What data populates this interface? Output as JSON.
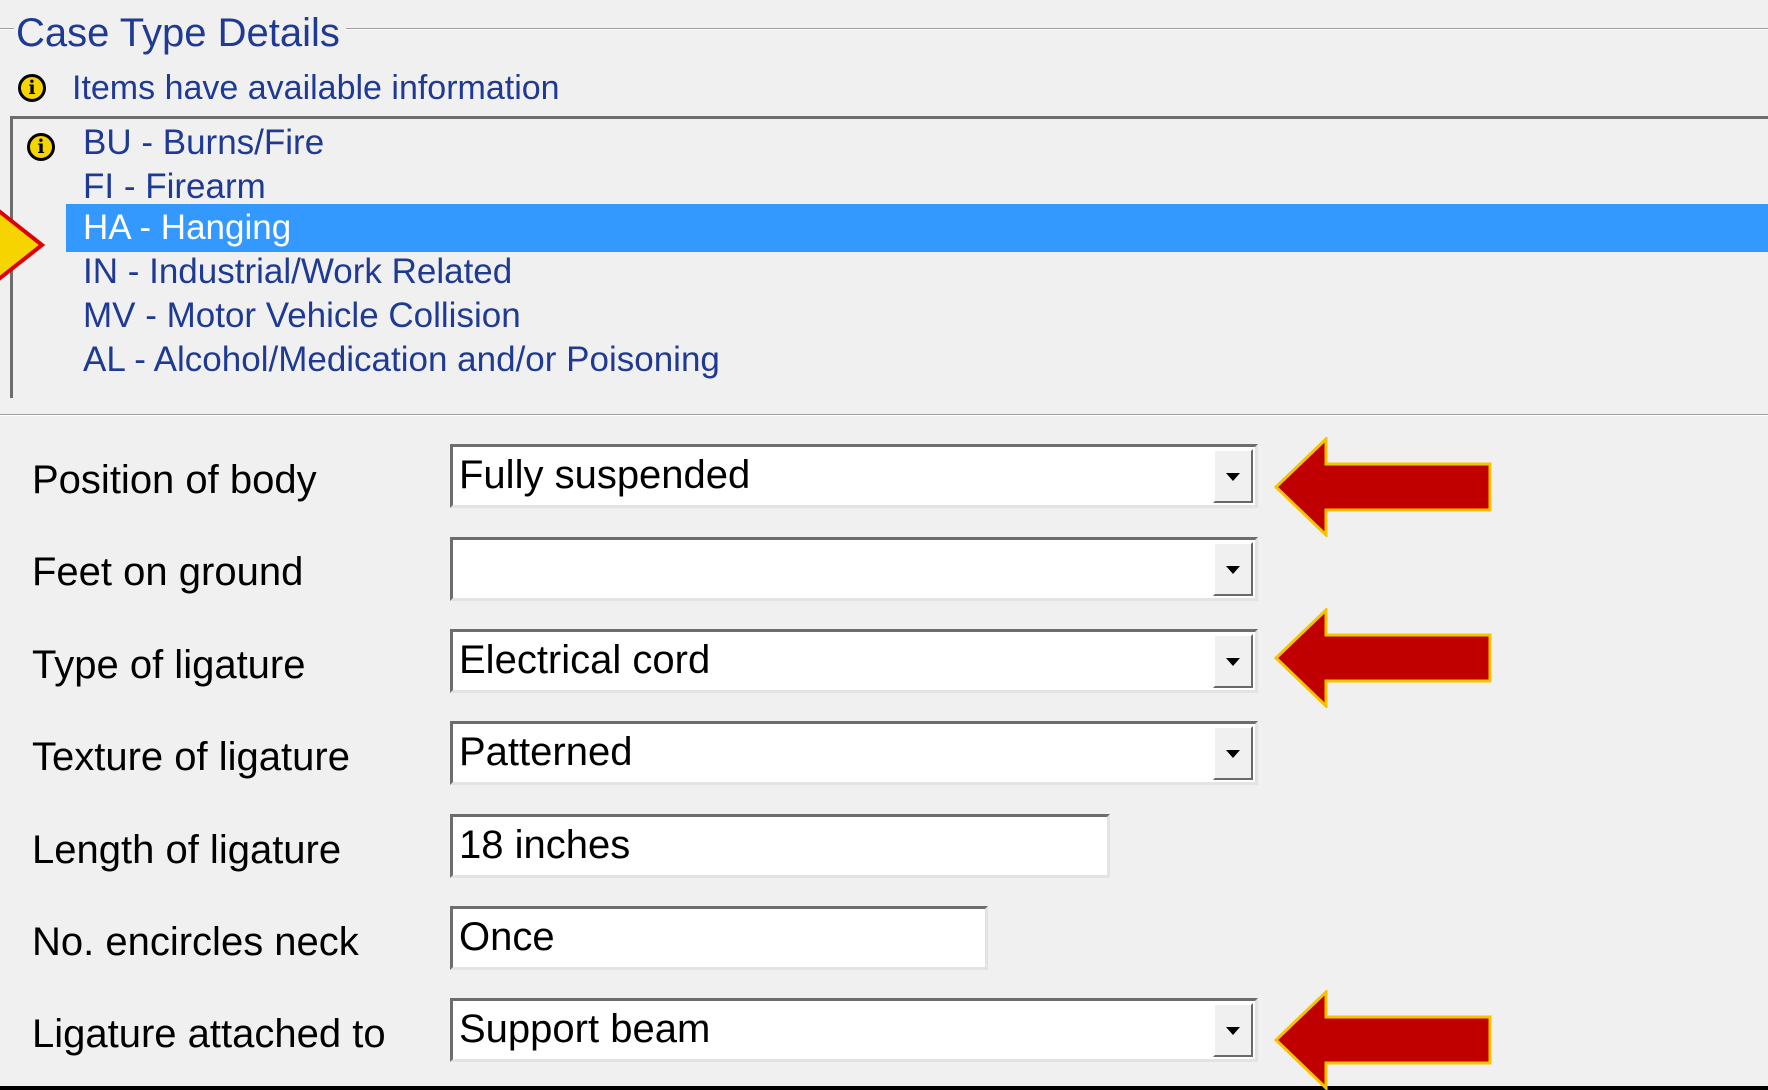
{
  "group": {
    "title": "Case Type Details",
    "info_icon": "info-icon",
    "info_legend": "Items have available information"
  },
  "case_types": [
    {
      "label": "BU - Burns/Fire",
      "has_info": true,
      "selected": false
    },
    {
      "label": "FI - Firearm",
      "has_info": false,
      "selected": false
    },
    {
      "label": "HA - Hanging",
      "has_info": false,
      "selected": true
    },
    {
      "label": "IN - Industrial/Work Related",
      "has_info": false,
      "selected": false
    },
    {
      "label": "MV - Motor Vehicle Collision",
      "has_info": false,
      "selected": false
    },
    {
      "label": "AL - Alcohol/Medication and/or Poisoning",
      "has_info": false,
      "selected": false
    }
  ],
  "fields": {
    "position_of_body": {
      "label": "Position of body",
      "value": "Fully suspended",
      "control": "combo",
      "highlighted": true
    },
    "feet_on_ground": {
      "label": "Feet on ground",
      "value": "",
      "control": "combo",
      "highlighted": false
    },
    "type_of_ligature": {
      "label": "Type of ligature",
      "value": "Electrical cord",
      "control": "combo",
      "highlighted": true
    },
    "texture_of_ligature": {
      "label": "Texture of ligature",
      "value": "Patterned",
      "control": "combo",
      "highlighted": false
    },
    "length_of_ligature": {
      "label": "Length of ligature",
      "value": "18 inches",
      "control": "text",
      "highlighted": false
    },
    "no_encircles_neck": {
      "label": "No. encircles neck",
      "value": "Once",
      "control": "text",
      "highlighted": false
    },
    "ligature_attached_to": {
      "label": "Ligature attached to",
      "value": "Support beam",
      "control": "combo",
      "highlighted": true
    }
  },
  "colors": {
    "background": "#f0f0f0",
    "link_text": "#1f3a93",
    "selection": "#3399ff",
    "arrow_fill": "#c00000",
    "arrow_outline": "#f5c400",
    "pointer_fill": "#f6d400",
    "pointer_outline": "#e00000"
  }
}
